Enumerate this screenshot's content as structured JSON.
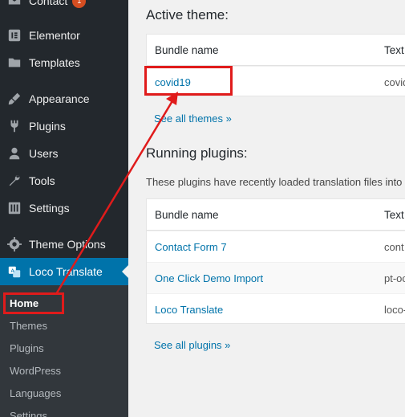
{
  "sidebar": {
    "items": [
      {
        "label": "Contact",
        "badge": "1",
        "icon": "envelope-icon"
      },
      {
        "label": "Elementor",
        "icon": "elementor-icon"
      },
      {
        "label": "Templates",
        "icon": "folder-icon"
      },
      {
        "label": "Appearance",
        "icon": "paintbrush-icon"
      },
      {
        "label": "Plugins",
        "icon": "plug-icon"
      },
      {
        "label": "Users",
        "icon": "user-icon"
      },
      {
        "label": "Tools",
        "icon": "wrench-icon"
      },
      {
        "label": "Settings",
        "icon": "settings-icon"
      },
      {
        "label": "Theme Options",
        "icon": "gear-icon"
      },
      {
        "label": "Loco Translate",
        "icon": "translate-icon"
      }
    ],
    "submenu": [
      "Home",
      "Themes",
      "Plugins",
      "WordPress",
      "Languages",
      "Settings"
    ]
  },
  "main": {
    "active_theme": {
      "heading": "Active theme:",
      "col_name": "Bundle name",
      "col_text": "Text",
      "rows": [
        {
          "name": "covid19",
          "text": "covid"
        }
      ],
      "see_all": "See all themes »"
    },
    "plugins": {
      "heading": "Running plugins:",
      "description": "These plugins have recently loaded translation files into t",
      "col_name": "Bundle name",
      "col_text": "Text",
      "rows": [
        {
          "name": "Contact Form 7",
          "text": "cont"
        },
        {
          "name": "One Click Demo Import",
          "text": "pt-oc"
        },
        {
          "name": "Loco Translate",
          "text": "loco-"
        }
      ],
      "see_all": "See all plugins »"
    }
  },
  "colors": {
    "sidebar": "#23282d",
    "active": "#0073aa",
    "link": "#0073aa",
    "annotation": "#e01b1b"
  }
}
